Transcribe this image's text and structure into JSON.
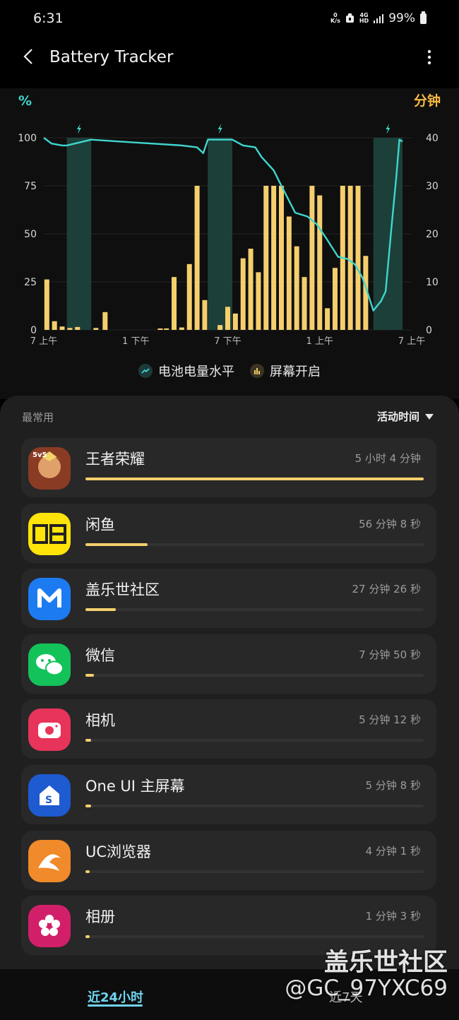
{
  "status_bar": {
    "time": "6:31",
    "net_speed_top": "0",
    "net_speed_unit": "K/s",
    "network_top": "4G",
    "network_bottom": "HD",
    "battery": "99%"
  },
  "header": {
    "title": "Battery Tracker"
  },
  "chart_data": {
    "type": "bar+line",
    "left_axis_label": "%",
    "right_axis_label": "分钟",
    "left_ticks": [
      "100",
      "75",
      "50",
      "25",
      "0"
    ],
    "right_ticks": [
      "40",
      "30",
      "20",
      "10",
      "0"
    ],
    "x_tick_labels": [
      "7 上午",
      "1 下午",
      "7 下午",
      "1 上午",
      "7 上午"
    ],
    "legend": [
      "电池电量水平",
      "屏幕开启"
    ],
    "ylim_left": [
      0,
      100
    ],
    "ylim_right": [
      0,
      40
    ],
    "xlim_hours": [
      0,
      24
    ],
    "charging_periods_hours": [
      [
        1.5,
        3.1
      ],
      [
        10.7,
        12.3
      ],
      [
        21.5,
        23.4
      ]
    ],
    "series": [
      {
        "name": "屏幕开启",
        "axis": "right",
        "x_hours": [
          0.2,
          0.7,
          1.2,
          1.7,
          2.2,
          3.4,
          4.0,
          7.6,
          8.0,
          8.5,
          9.0,
          9.5,
          10.0,
          10.5,
          11.5,
          12.0,
          12.5,
          13.0,
          13.5,
          14.0,
          14.5,
          15.0,
          15.5,
          16.0,
          16.5,
          17.0,
          17.5,
          18.0,
          18.5,
          19.0,
          19.5,
          20.0,
          20.5,
          21.0
        ],
        "values": [
          10.5,
          1.8,
          0.7,
          0.4,
          0.6,
          0.4,
          3.7,
          0.3,
          0.3,
          11,
          0.5,
          13.7,
          30,
          6.2,
          1.0,
          4.8,
          3.4,
          14.9,
          16.9,
          12,
          30,
          30,
          30,
          23.6,
          17.4,
          11,
          30,
          28,
          4.5,
          12.9,
          30,
          30,
          30,
          15.4
        ]
      },
      {
        "name": "电池电量水平",
        "axis": "left",
        "x_hours": [
          0,
          0.5,
          1.2,
          1.5,
          3.1,
          5,
          7,
          9,
          10.0,
          10.4,
          10.7,
          12.3,
          13.0,
          13.8,
          14.2,
          15.0,
          15.5,
          16.4,
          17.2,
          17.8,
          18.4,
          19.2,
          19.8,
          20.3,
          20.8,
          21.1,
          21.5,
          22.0,
          22.3,
          22.7,
          23.0,
          23.2,
          23.4
        ],
        "values": [
          100,
          97,
          96,
          96,
          99,
          98,
          97,
          96,
          95,
          92,
          99,
          99,
          96,
          95,
          90,
          83,
          75,
          61,
          59,
          55,
          48,
          38,
          37,
          34,
          27,
          20,
          10,
          15,
          20,
          55,
          80,
          99,
          98
        ]
      }
    ]
  },
  "list": {
    "section_title": "最常用",
    "sort_label": "活动时间",
    "items": [
      {
        "name": "王者荣耀",
        "time": "5 小时 4 分钟",
        "fraction": 1.0,
        "icon": "honor-of-kings-icon",
        "color": "#8a3b24"
      },
      {
        "name": "闲鱼",
        "time": "56 分钟 8 秒",
        "fraction": 0.184,
        "icon": "xianyu-icon",
        "color": "#ffe40a"
      },
      {
        "name": "盖乐世社区",
        "time": "27 分钟 26 秒",
        "fraction": 0.09,
        "icon": "galaxy-members-icon",
        "color": "#1d7bf2"
      },
      {
        "name": "微信",
        "time": "7 分钟 50 秒",
        "fraction": 0.026,
        "icon": "wechat-icon",
        "color": "#13c35a"
      },
      {
        "name": "相机",
        "time": "5 分钟 12 秒",
        "fraction": 0.017,
        "icon": "camera-icon",
        "color": "#e8345a"
      },
      {
        "name": "One UI 主屏幕",
        "time": "5 分钟 8 秒",
        "fraction": 0.017,
        "icon": "one-ui-home-icon",
        "color": "#1e5ad0"
      },
      {
        "name": "UC浏览器",
        "time": "4 分钟 1 秒",
        "fraction": 0.013,
        "icon": "uc-browser-icon",
        "color": "#f08a2a"
      },
      {
        "name": "相册",
        "time": "1 分钟 3 秒",
        "fraction": 0.004,
        "icon": "gallery-icon",
        "color": "#d21f6a"
      }
    ]
  },
  "bottom_nav": {
    "tab_24h": "近24小时",
    "tab_7d": "近7天"
  },
  "watermark": {
    "line1": "盖乐世社区",
    "line2": "@GC_97YXC69"
  },
  "colors": {
    "accent": "#3fd6cf",
    "bar": "#f5cf6e",
    "charge": "#1d3f39",
    "tab_active": "#6fd4f0"
  }
}
